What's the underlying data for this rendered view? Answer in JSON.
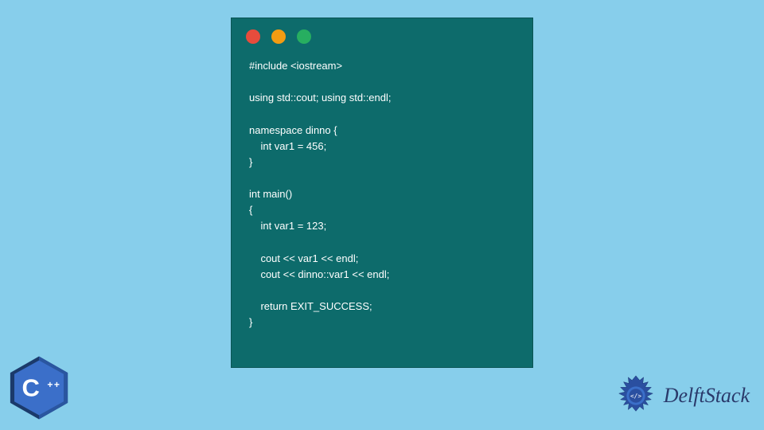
{
  "window": {
    "dots": [
      "red",
      "yellow",
      "green"
    ]
  },
  "code": "#include <iostream>\n\nusing std::cout; using std::endl;\n\nnamespace dinno {\n    int var1 = 456;\n}\n\nint main()\n{\n    int var1 = 123;\n\n    cout << var1 << endl;\n    cout << dinno::var1 << endl;\n\n    return EXIT_SUCCESS;\n}",
  "cpp_badge": {
    "label": "C++"
  },
  "brand": {
    "name": "DelftStack"
  }
}
